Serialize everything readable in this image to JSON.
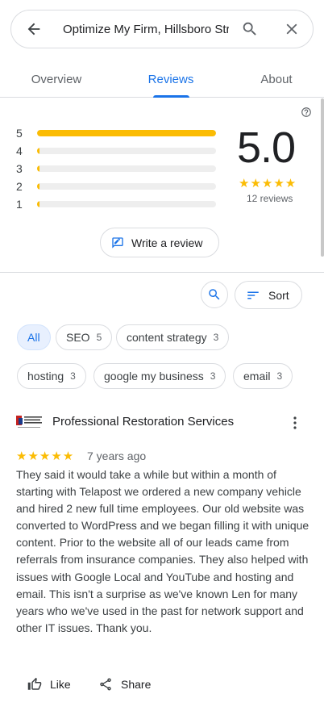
{
  "search": {
    "query": "Optimize My Firm, Hillsboro Str"
  },
  "tabs": [
    {
      "label": "Overview"
    },
    {
      "label": "Reviews"
    },
    {
      "label": "About"
    }
  ],
  "summary": {
    "rating": "5.0",
    "stars": "★★★★★",
    "review_count": "12 reviews",
    "histogram": [
      {
        "label": "5",
        "fill": 1.0
      },
      {
        "label": "4",
        "fill": 0.01
      },
      {
        "label": "3",
        "fill": 0.01
      },
      {
        "label": "2",
        "fill": 0.01
      },
      {
        "label": "1",
        "fill": 0.01
      }
    ],
    "write_review_label": "Write a review"
  },
  "controls": {
    "sort_label": "Sort"
  },
  "chips": [
    {
      "label": "All",
      "count": "",
      "selected": true
    },
    {
      "label": "SEO",
      "count": "5"
    },
    {
      "label": "content strategy",
      "count": "3"
    },
    {
      "label": "hosting",
      "count": "3"
    },
    {
      "label": "google my business",
      "count": "3"
    },
    {
      "label": "email",
      "count": "3"
    }
  ],
  "review": {
    "author": "Professional Restoration Services",
    "stars": "★★★★★",
    "date": "7 years ago",
    "text": "They said it would take a while but within a month of starting with Telapost we ordered a new company vehicle and hired 2 new full time employees. Our old website was converted to WordPress and we began filling it with unique content. Prior to the website all of our leads came from referrals from insurance companies. They also helped with issues with Google Local and YouTube and hosting and email. This isn't a surprise as we've known Len for many years who we've used in the past for network support and other IT issues. Thank you.",
    "like_label": "Like",
    "share_label": "Share"
  },
  "colors": {
    "accent": "#1a73e8",
    "star": "#fbbc04",
    "border": "#dadce0"
  }
}
